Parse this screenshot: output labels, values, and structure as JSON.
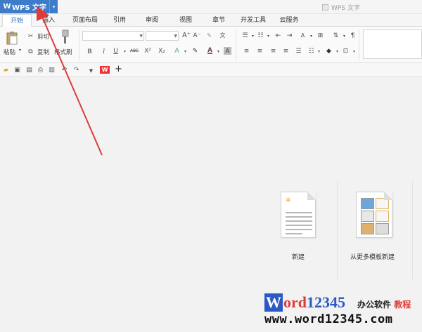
{
  "app": {
    "button_label": "WPS 文字",
    "logo_glyph": "W",
    "dropdown_glyph": "▾",
    "window_title": "WPS 文字"
  },
  "tabs": [
    "开始",
    "插入",
    "页面布局",
    "引用",
    "审阅",
    "视图",
    "章节",
    "开发工具",
    "云服务"
  ],
  "ribbon": {
    "paste": "粘贴",
    "cut": "剪切",
    "copy": "复制",
    "format_painter": "格式刷",
    "font_name": "",
    "font_size": "",
    "bold": "B",
    "italic": "I",
    "underline": "U",
    "strike": "ABC",
    "superscript": "X²",
    "subscript": "X₂",
    "font_color": "A",
    "grow_font": "A⁺",
    "shrink_font": "A⁻"
  },
  "quick_access": {
    "new": "new-file-icon",
    "add": "+"
  },
  "start_page": {
    "new_label": "新建",
    "template_label": "从更多模板新建"
  },
  "watermark": {
    "w": "W",
    "word": "ord",
    "num": "12345",
    "cn1": "办公软件",
    "cn2": "教程",
    "url": "www.word12345.com"
  },
  "colors": {
    "accent": "#3d7cc9",
    "arrow": "#e03a3a",
    "tab_active_text": "#2b6fc2"
  }
}
